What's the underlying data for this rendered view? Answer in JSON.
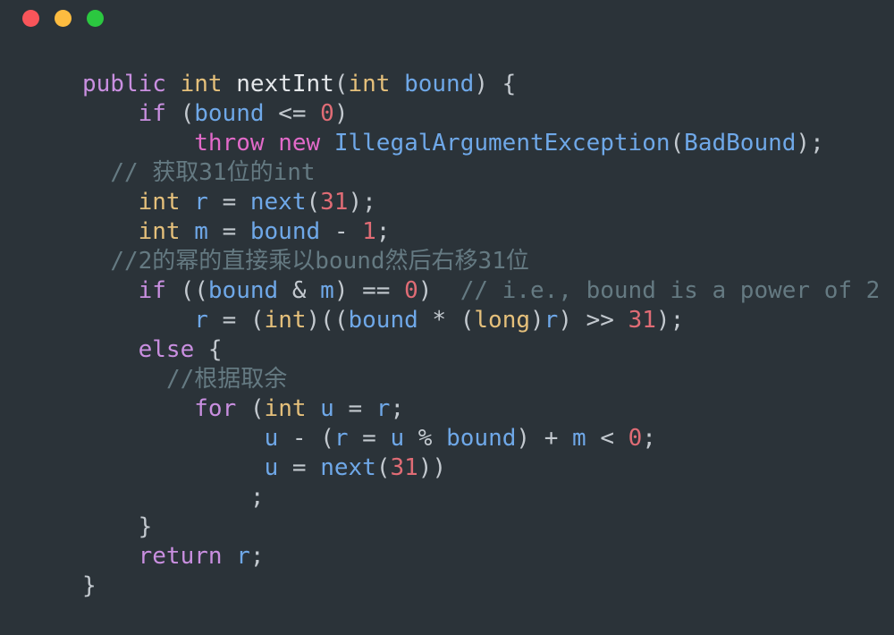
{
  "window": {
    "background_color": "#2b3339",
    "traffic_lights": [
      {
        "name": "close",
        "color": "#f9555a",
        "label": "Close"
      },
      {
        "name": "minimize",
        "color": "#fdbc40",
        "label": "Minimize"
      },
      {
        "name": "zoom",
        "color": "#2bc840",
        "label": "Zoom"
      }
    ]
  },
  "theme": {
    "background": "#2b3339",
    "keyword": "#c98fe0",
    "keyword_alt": "#e26ac9",
    "type": "#e5c07b",
    "identifier": "#6fa8e8",
    "function": "#e4e7ea",
    "number": "#e06c75",
    "punctuation": "#c3c9cf",
    "comment": "#657a82"
  },
  "editor": {
    "language": "Java",
    "font_size_px": 26,
    "line_height_px": 33,
    "lines": [
      {
        "indent": 0,
        "tokens": [
          {
            "t": "public",
            "c": "kw"
          },
          {
            "t": " ",
            "c": "pn"
          },
          {
            "t": "int",
            "c": "typ"
          },
          {
            "t": " ",
            "c": "pn"
          },
          {
            "t": "nextInt",
            "c": "fn"
          },
          {
            "t": "(",
            "c": "pn"
          },
          {
            "t": "int",
            "c": "typ"
          },
          {
            "t": " ",
            "c": "pn"
          },
          {
            "t": "bound",
            "c": "id"
          },
          {
            "t": ")",
            "c": "pn"
          },
          {
            "t": " ",
            "c": "pn"
          },
          {
            "t": "{",
            "c": "pn"
          }
        ]
      },
      {
        "indent": 4,
        "tokens": [
          {
            "t": "if",
            "c": "kw"
          },
          {
            "t": " (",
            "c": "pn"
          },
          {
            "t": "bound",
            "c": "id"
          },
          {
            "t": " ",
            "c": "pn"
          },
          {
            "t": "<=",
            "c": "pn"
          },
          {
            "t": " ",
            "c": "pn"
          },
          {
            "t": "0",
            "c": "zero"
          },
          {
            "t": ")",
            "c": "pn"
          }
        ]
      },
      {
        "indent": 8,
        "tokens": [
          {
            "t": "throw",
            "c": "kw2"
          },
          {
            "t": " ",
            "c": "pn"
          },
          {
            "t": "new",
            "c": "kw2"
          },
          {
            "t": " ",
            "c": "pn"
          },
          {
            "t": "IllegalArgumentException",
            "c": "id"
          },
          {
            "t": "(",
            "c": "pn"
          },
          {
            "t": "BadBound",
            "c": "id"
          },
          {
            "t": ")",
            "c": "pn"
          },
          {
            "t": ";",
            "c": "pn"
          }
        ]
      },
      {
        "indent": 2,
        "tokens": [
          {
            "t": "// 获取31位的int",
            "c": "cmt"
          }
        ]
      },
      {
        "indent": 4,
        "tokens": [
          {
            "t": "int",
            "c": "typ"
          },
          {
            "t": " ",
            "c": "pn"
          },
          {
            "t": "r",
            "c": "id"
          },
          {
            "t": " ",
            "c": "pn"
          },
          {
            "t": "=",
            "c": "pn"
          },
          {
            "t": " ",
            "c": "pn"
          },
          {
            "t": "next",
            "c": "id"
          },
          {
            "t": "(",
            "c": "pn"
          },
          {
            "t": "31",
            "c": "num"
          },
          {
            "t": ")",
            "c": "pn"
          },
          {
            "t": ";",
            "c": "pn"
          }
        ]
      },
      {
        "indent": 4,
        "tokens": [
          {
            "t": "int",
            "c": "typ"
          },
          {
            "t": " ",
            "c": "pn"
          },
          {
            "t": "m",
            "c": "id"
          },
          {
            "t": " ",
            "c": "pn"
          },
          {
            "t": "=",
            "c": "pn"
          },
          {
            "t": " ",
            "c": "pn"
          },
          {
            "t": "bound",
            "c": "id"
          },
          {
            "t": " ",
            "c": "pn"
          },
          {
            "t": "-",
            "c": "pn"
          },
          {
            "t": " ",
            "c": "pn"
          },
          {
            "t": "1",
            "c": "num"
          },
          {
            "t": ";",
            "c": "pn"
          }
        ]
      },
      {
        "indent": 2,
        "tokens": [
          {
            "t": "//2的幂的直接乘以bound然后右移31位",
            "c": "cmt"
          }
        ]
      },
      {
        "indent": 4,
        "tokens": [
          {
            "t": "if",
            "c": "kw"
          },
          {
            "t": " ((",
            "c": "pn"
          },
          {
            "t": "bound",
            "c": "id"
          },
          {
            "t": " ",
            "c": "pn"
          },
          {
            "t": "&",
            "c": "pn"
          },
          {
            "t": " ",
            "c": "pn"
          },
          {
            "t": "m",
            "c": "id"
          },
          {
            "t": ")",
            "c": "pn"
          },
          {
            "t": " ",
            "c": "pn"
          },
          {
            "t": "==",
            "c": "pn"
          },
          {
            "t": " ",
            "c": "pn"
          },
          {
            "t": "0",
            "c": "zero"
          },
          {
            "t": ")",
            "c": "pn"
          },
          {
            "t": "  ",
            "c": "pn"
          },
          {
            "t": "// i.e., bound is a power of 2",
            "c": "cmt"
          }
        ]
      },
      {
        "indent": 8,
        "tokens": [
          {
            "t": "r",
            "c": "id"
          },
          {
            "t": " ",
            "c": "pn"
          },
          {
            "t": "=",
            "c": "pn"
          },
          {
            "t": " (",
            "c": "pn"
          },
          {
            "t": "int",
            "c": "typ"
          },
          {
            "t": ")((",
            "c": "pn"
          },
          {
            "t": "bound",
            "c": "id"
          },
          {
            "t": " ",
            "c": "pn"
          },
          {
            "t": "*",
            "c": "pn"
          },
          {
            "t": " (",
            "c": "pn"
          },
          {
            "t": "long",
            "c": "typ"
          },
          {
            "t": ")",
            "c": "pn"
          },
          {
            "t": "r",
            "c": "id"
          },
          {
            "t": ")",
            "c": "pn"
          },
          {
            "t": " ",
            "c": "pn"
          },
          {
            "t": ">>",
            "c": "pn"
          },
          {
            "t": " ",
            "c": "pn"
          },
          {
            "t": "31",
            "c": "num"
          },
          {
            "t": ")",
            "c": "pn"
          },
          {
            "t": ";",
            "c": "pn"
          }
        ]
      },
      {
        "indent": 4,
        "tokens": [
          {
            "t": "else",
            "c": "kw"
          },
          {
            "t": " ",
            "c": "pn"
          },
          {
            "t": "{",
            "c": "pn"
          }
        ]
      },
      {
        "indent": 6,
        "tokens": [
          {
            "t": "//根据取余",
            "c": "cmt"
          }
        ]
      },
      {
        "indent": 8,
        "tokens": [
          {
            "t": "for",
            "c": "kw"
          },
          {
            "t": " (",
            "c": "pn"
          },
          {
            "t": "int",
            "c": "typ"
          },
          {
            "t": " ",
            "c": "pn"
          },
          {
            "t": "u",
            "c": "id"
          },
          {
            "t": " ",
            "c": "pn"
          },
          {
            "t": "=",
            "c": "pn"
          },
          {
            "t": " ",
            "c": "pn"
          },
          {
            "t": "r",
            "c": "id"
          },
          {
            "t": ";",
            "c": "pn"
          }
        ]
      },
      {
        "indent": 13,
        "tokens": [
          {
            "t": "u",
            "c": "id"
          },
          {
            "t": " ",
            "c": "pn"
          },
          {
            "t": "-",
            "c": "pn"
          },
          {
            "t": " (",
            "c": "pn"
          },
          {
            "t": "r",
            "c": "id"
          },
          {
            "t": " ",
            "c": "pn"
          },
          {
            "t": "=",
            "c": "pn"
          },
          {
            "t": " ",
            "c": "pn"
          },
          {
            "t": "u",
            "c": "id"
          },
          {
            "t": " ",
            "c": "pn"
          },
          {
            "t": "%",
            "c": "pn"
          },
          {
            "t": " ",
            "c": "pn"
          },
          {
            "t": "bound",
            "c": "id"
          },
          {
            "t": ")",
            "c": "pn"
          },
          {
            "t": " ",
            "c": "pn"
          },
          {
            "t": "+",
            "c": "pn"
          },
          {
            "t": " ",
            "c": "pn"
          },
          {
            "t": "m",
            "c": "id"
          },
          {
            "t": " ",
            "c": "pn"
          },
          {
            "t": "<",
            "c": "pn"
          },
          {
            "t": " ",
            "c": "pn"
          },
          {
            "t": "0",
            "c": "zero"
          },
          {
            "t": ";",
            "c": "pn"
          }
        ]
      },
      {
        "indent": 13,
        "tokens": [
          {
            "t": "u",
            "c": "id"
          },
          {
            "t": " ",
            "c": "pn"
          },
          {
            "t": "=",
            "c": "pn"
          },
          {
            "t": " ",
            "c": "pn"
          },
          {
            "t": "next",
            "c": "id"
          },
          {
            "t": "(",
            "c": "pn"
          },
          {
            "t": "31",
            "c": "num"
          },
          {
            "t": "))",
            "c": "pn"
          }
        ]
      },
      {
        "indent": 12,
        "tokens": [
          {
            "t": ";",
            "c": "pn"
          }
        ]
      },
      {
        "indent": 4,
        "tokens": [
          {
            "t": "}",
            "c": "pn"
          }
        ]
      },
      {
        "indent": 4,
        "tokens": [
          {
            "t": "return",
            "c": "kw"
          },
          {
            "t": " ",
            "c": "pn"
          },
          {
            "t": "r",
            "c": "id"
          },
          {
            "t": ";",
            "c": "pn"
          }
        ]
      },
      {
        "indent": 0,
        "tokens": [
          {
            "t": "}",
            "c": "pn"
          }
        ]
      }
    ]
  }
}
